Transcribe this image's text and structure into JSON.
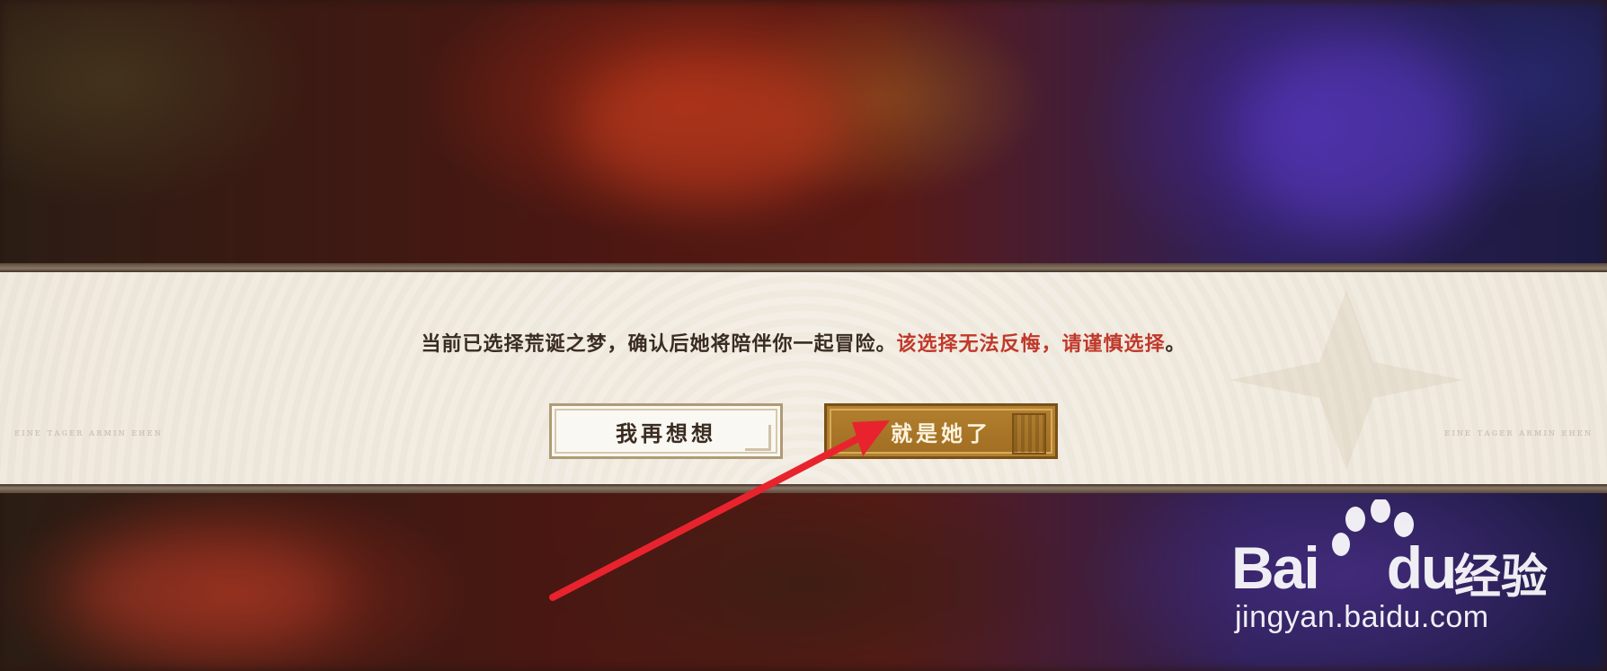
{
  "dialog": {
    "message_main": "当前已选择荒诞之梦，确认后她将陪伴你一起冒险。",
    "message_warning": "该选择无法反悔，请谨慎选择",
    "message_end": "。",
    "side_text_left": "ᴇɪɴᴇ ᴛᴀɢᴇʀ ᴀʀᴍɪɴ ᴇʜᴇɴ",
    "side_text_right": "ᴇɪɴᴇ ᴛᴀɢᴇʀ ᴀʀᴍɪɴ ᴇʜᴇɴ",
    "cancel_label": "我再想想",
    "confirm_label": "就是她了"
  },
  "watermark": {
    "logo_text_1": "Bai",
    "logo_text_2": "du",
    "logo_cn": "经验",
    "url": "jingyan.baidu.com"
  },
  "colors": {
    "warning": "#c0392b",
    "confirm_bg": "#a87428",
    "annotation_arrow": "#e8232e"
  },
  "icons": [
    "red-annotation-arrow-icon",
    "baidu-paw-icon"
  ]
}
